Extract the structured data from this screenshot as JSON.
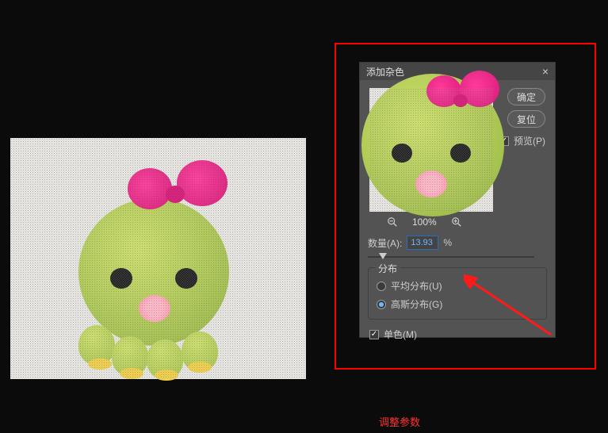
{
  "dialog": {
    "title": "添加杂色",
    "ok_label": "确定",
    "reset_label": "复位",
    "preview_label": "预览(P)",
    "preview_checked": true,
    "zoom_text": "100%",
    "amount_label": "数量(A):",
    "amount_value": "13.93",
    "amount_unit": "%",
    "distribution_title": "分布",
    "uniform_label": "平均分布(U)",
    "gaussian_label": "高斯分布(G)",
    "selected_distribution": "gaussian",
    "mono_label": "单色(M)",
    "mono_checked": true
  },
  "caption": "调整参数"
}
